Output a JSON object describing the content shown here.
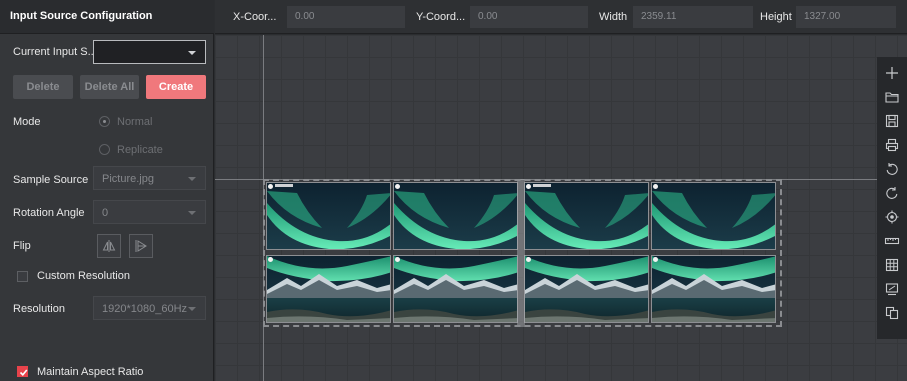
{
  "panel": {
    "title": "Input Source Configuration",
    "current_input_label": "Current Input S...",
    "current_input_value": "",
    "buttons": {
      "delete": "Delete",
      "delete_all": "Delete All",
      "create": "Create"
    },
    "mode": {
      "label": "Mode",
      "options": [
        "Normal",
        "Replicate"
      ],
      "selected": "Normal"
    },
    "sample_source": {
      "label": "Sample Source",
      "value": "Picture.jpg"
    },
    "rotation_angle": {
      "label": "Rotation Angle",
      "value": "0"
    },
    "flip": {
      "label": "Flip"
    },
    "custom_resolution": {
      "label": "Custom Resolution",
      "checked": false
    },
    "resolution": {
      "label": "Resolution",
      "value": "1920*1080_60Hz"
    },
    "maintain_aspect_ratio": {
      "label": "Maintain Aspect Ratio",
      "checked": true
    }
  },
  "topbar": {
    "x": {
      "label": "X-Coor...",
      "value": "0.00"
    },
    "y": {
      "label": "Y-Coord...",
      "value": "0.00"
    },
    "width": {
      "label": "Width",
      "value": "2359.11"
    },
    "height": {
      "label": "Height",
      "value": "1327.00"
    }
  },
  "toolbar": {
    "icons": [
      "plus-icon",
      "folder-icon",
      "save-icon",
      "print-icon",
      "undo-icon",
      "redo-icon",
      "locate-icon",
      "ruler-icon",
      "grid-icon",
      "screen-icon",
      "copy-icon"
    ]
  },
  "colors": {
    "accent": "#f0787c",
    "checkbox_checked": "#e8434b",
    "panel_bg": "#35373a",
    "canvas_bg": "#3b3d41"
  }
}
